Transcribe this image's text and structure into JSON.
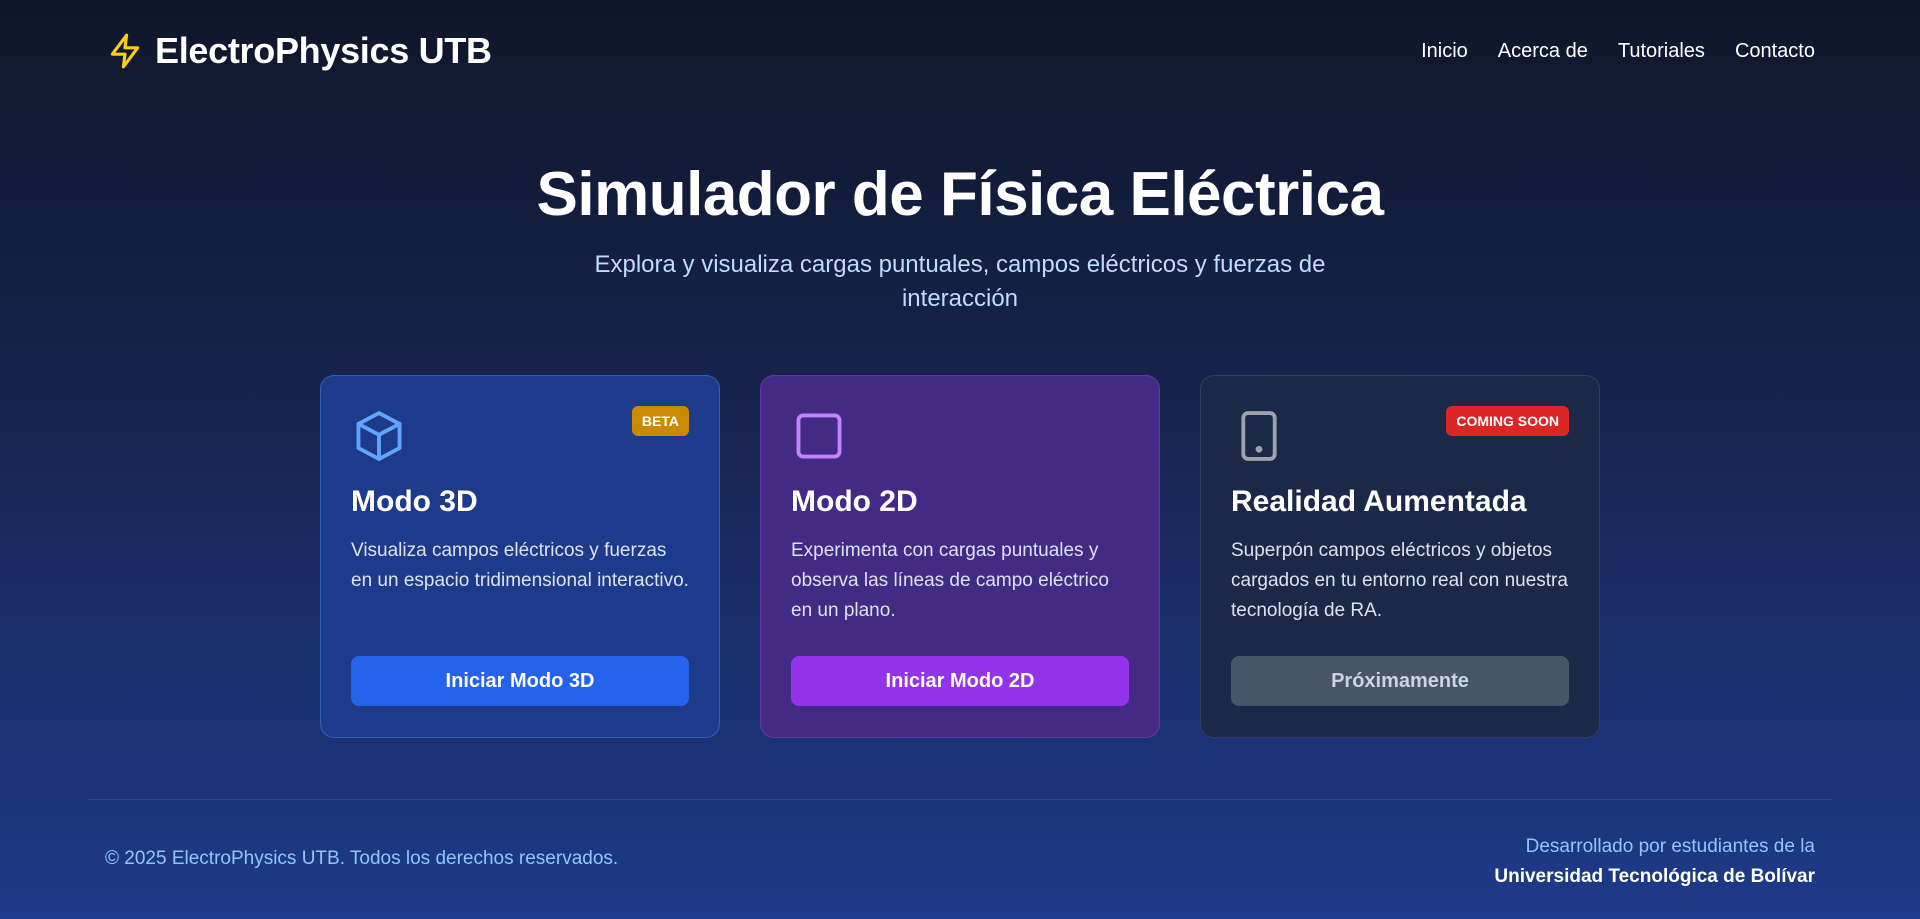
{
  "brand": {
    "name": "ElectroPhysics UTB",
    "icon": "lightning-bolt-icon",
    "icon_color": "#facc15"
  },
  "nav": {
    "items": [
      "Inicio",
      "Acerca de",
      "Tutoriales",
      "Contacto"
    ]
  },
  "hero": {
    "title": "Simulador de Física Eléctrica",
    "subtitle": "Explora y visualiza cargas puntuales, campos eléctricos y fuerzas de interacción"
  },
  "cards": [
    {
      "icon": "cube-icon",
      "icon_color": "#60a5fa",
      "badge": "BETA",
      "title": "Modo 3D",
      "description": "Visualiza campos eléctricos y fuerzas en un espacio tridimensional interactivo.",
      "button": "Iniciar Modo 3D",
      "button_color": "#2563eb"
    },
    {
      "icon": "square-icon",
      "icon_color": "#c084fc",
      "badge": "",
      "title": "Modo 2D",
      "description": "Experimenta con cargas puntuales y observa las líneas de campo eléctrico en un plano.",
      "button": "Iniciar Modo 2D",
      "button_color": "#9333ea"
    },
    {
      "icon": "tablet-icon",
      "icon_color": "#9ca3af",
      "badge": "COMING SOON",
      "title": "Realidad Aumentada",
      "description": "Superpón campos eléctricos y objetos cargados en tu entorno real con nuestra tecnología de RA.",
      "button": "Próximamente",
      "button_color": "#475569"
    }
  ],
  "footer": {
    "copyright": "© 2025 ElectroPhysics UTB. Todos los derechos reservados.",
    "developed_by": "Desarrollado por estudiantes de la",
    "university": "Universidad Tecnológica de Bolívar"
  }
}
